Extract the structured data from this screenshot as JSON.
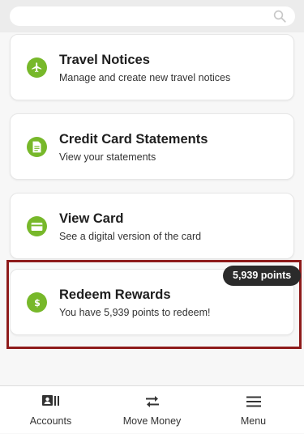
{
  "search": {
    "icon": "search-icon"
  },
  "cards": [
    {
      "title": "Travel Notices",
      "subtitle": "Manage and create new travel notices",
      "icon": "airplane-icon"
    },
    {
      "title": "Credit Card Statements",
      "subtitle": "View your statements",
      "icon": "document-icon"
    },
    {
      "title": "View Card",
      "subtitle": "See a digital version of the card",
      "icon": "credit-card-icon"
    },
    {
      "title": "Redeem Rewards",
      "subtitle": "You have 5,939 points to redeem!",
      "icon": "dollar-icon",
      "badge": "5,939 points"
    }
  ],
  "nav": {
    "accounts": "Accounts",
    "move_money": "Move Money",
    "menu": "Menu"
  },
  "colors": {
    "accent_green": "#77b82a",
    "highlight_red": "#8e1b1b",
    "badge_bg": "#2b2b2b"
  }
}
